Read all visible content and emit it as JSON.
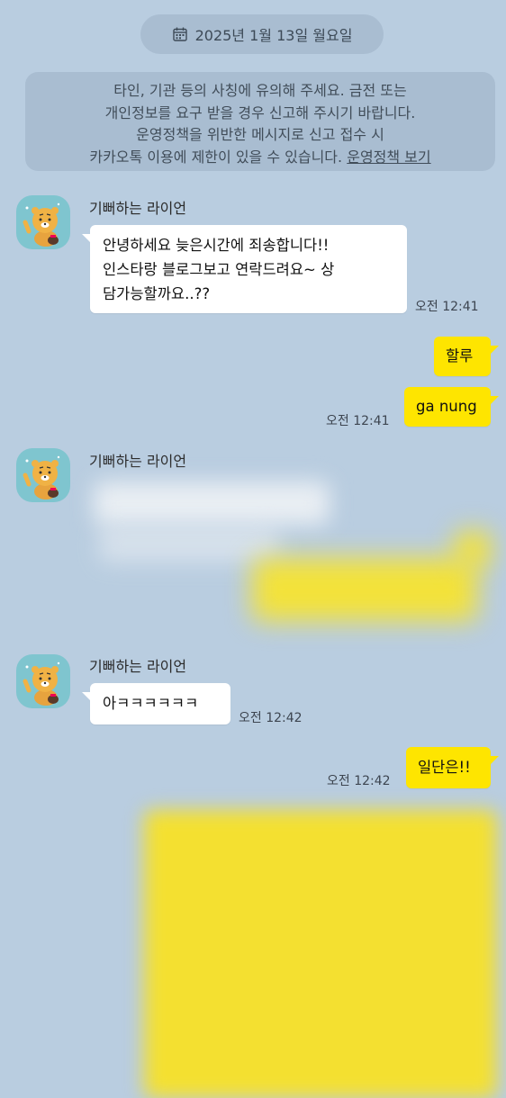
{
  "date_divider": {
    "icon": "calendar-icon",
    "label": "2025년 1월 13일 월요일"
  },
  "notice": {
    "lines": [
      "타인, 기관 등의 사칭에 유의해 주세요. 금전 또는",
      "개인정보를 요구 받을 경우 신고해 주시기 바랍니다.",
      "운영정책을 위반한 메시지로 신고 접수 시",
      "카카오톡 이용에 제한이 있을 수 있습니다."
    ],
    "link": "운영정책 보기"
  },
  "messages": [
    {
      "sender": "기뻐하는 라이언",
      "lines": [
        "안녕하세요 늦은시간에 죄송합니다!!",
        "인스타랑 블로그보고 연락드려요~ 상",
        "담가능할까요..??"
      ],
      "time": "오전 12:41"
    },
    {
      "outgoing": "할루"
    },
    {
      "outgoing": "ga nung",
      "time": "오전 12:41"
    },
    {
      "sender": "기뻐하는 라이언"
    },
    {
      "sender": "기뻐하는 라이언",
      "text": "아ㅋㅋㅋㅋㅋㅋ",
      "time": "오전 12:42"
    },
    {
      "outgoing": "일단은!!",
      "time": "오전 12:42"
    }
  ],
  "colors": {
    "background": "#b9cde0",
    "outgoing_bubble": "#fee500",
    "incoming_bubble": "#ffffff"
  },
  "avatar_icon": "ryan-lion-avatar-icon"
}
